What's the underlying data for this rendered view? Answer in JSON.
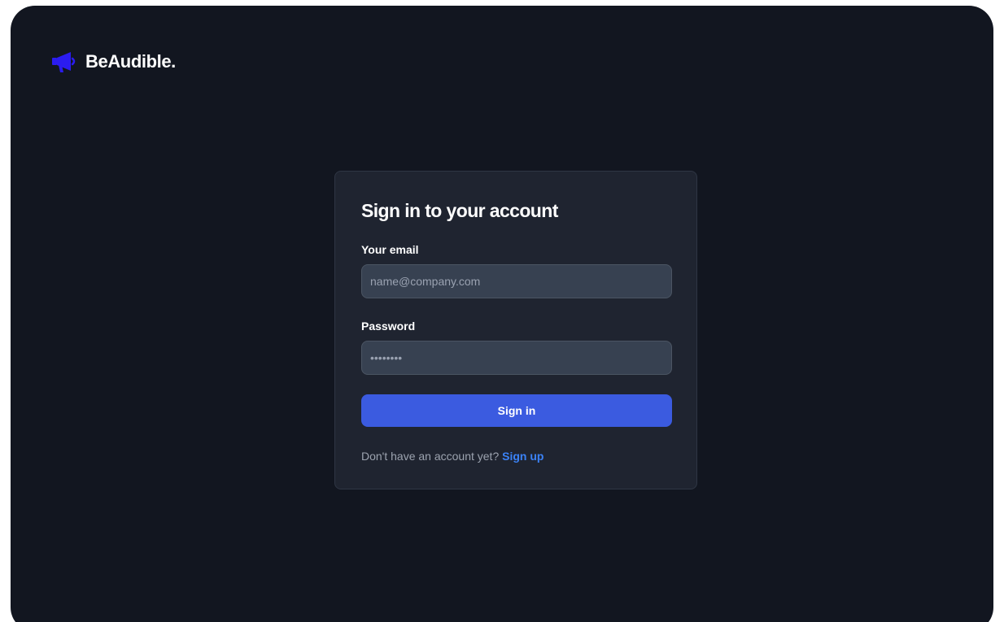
{
  "brand": {
    "name": "BeAudible.",
    "icon": "megaphone-icon",
    "icon_color": "#2b1cf0"
  },
  "card": {
    "title": "Sign in to your account",
    "email": {
      "label": "Your email",
      "placeholder": "name@company.com",
      "value": ""
    },
    "password": {
      "label": "Password",
      "placeholder": "••••••••",
      "value": ""
    },
    "submit_label": "Sign in",
    "footer": {
      "prompt": "Don't have an account yet?",
      "link_label": "Sign up"
    }
  },
  "colors": {
    "background": "#121620",
    "card": "#1f2430",
    "input": "#374151",
    "primary": "#3b5be0",
    "link": "#3b82f6"
  }
}
